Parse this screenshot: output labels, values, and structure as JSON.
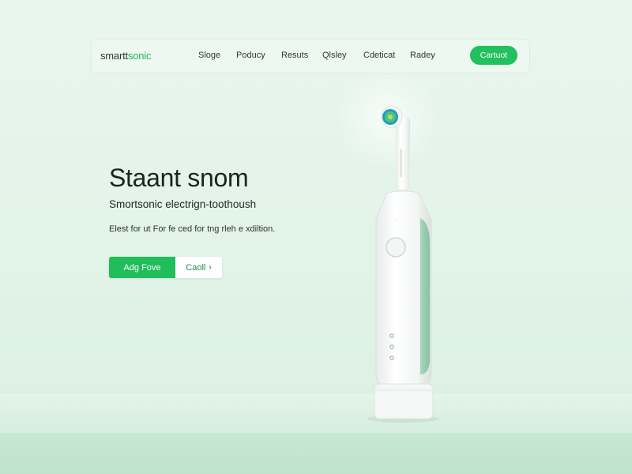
{
  "nav": {
    "logo_prefix": "smartt",
    "logo_suffix": "sonic",
    "links": [
      {
        "label": "Sloge"
      },
      {
        "label": "Poducy"
      },
      {
        "label": "Resuts"
      },
      {
        "label": "Qlsley"
      },
      {
        "label": "Cdeticat"
      },
      {
        "label": "Radey"
      }
    ],
    "contact_label": "Cartuot"
  },
  "hero": {
    "title": "Staant snom",
    "subtitle": "Smortsonic electrign-toothoush",
    "description": "Elest for ut For fe ced for tng rleh e xdiltion.",
    "primary_button": "Adg Fove",
    "secondary_button": "Caoll",
    "secondary_chevron": "›"
  },
  "colors": {
    "accent": "#22c05e",
    "background": "#e6f5ec",
    "product": "#f7f9f8",
    "product_grip": "#9ccdb2"
  },
  "icons": {
    "power_button": "circle-button",
    "mode_indicators": "dot-indicators"
  }
}
